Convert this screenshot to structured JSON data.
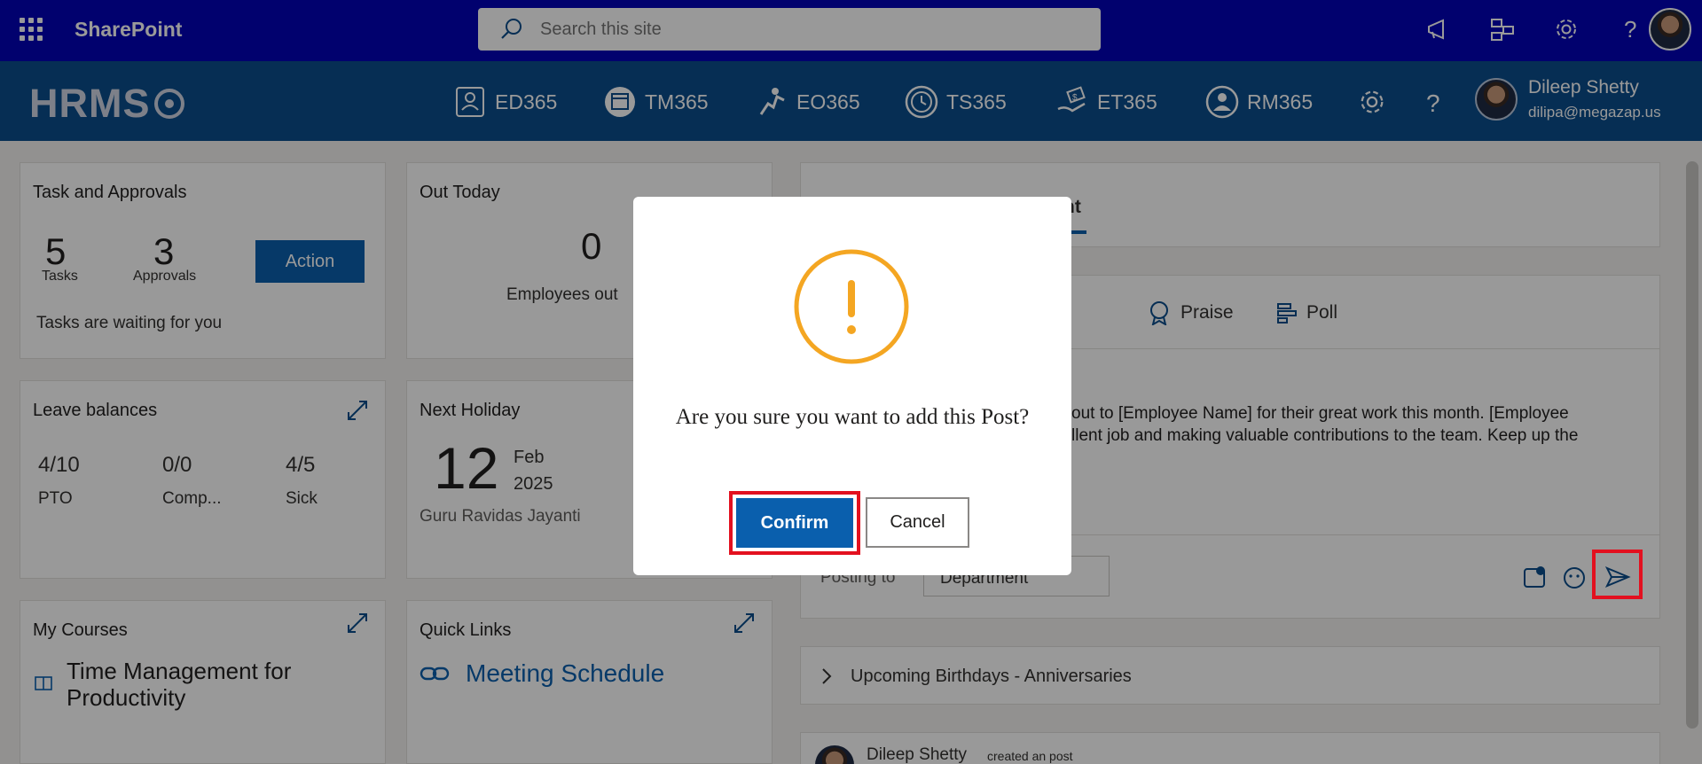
{
  "topbar": {
    "app_title": "SharePoint",
    "search_placeholder": "Search this site"
  },
  "hrms": {
    "logo": "HRMS",
    "nav": [
      {
        "label": "ED365",
        "icon": "employee-directory-icon"
      },
      {
        "label": "TM365",
        "icon": "calendar-icon"
      },
      {
        "label": "EO365",
        "icon": "onboarding-icon"
      },
      {
        "label": "TS365",
        "icon": "clock-icon"
      },
      {
        "label": "ET365",
        "icon": "expense-icon"
      },
      {
        "label": "RM365",
        "icon": "person-icon"
      }
    ],
    "user": {
      "name": "Dileep Shetty",
      "email": "dilipa@megazap.us"
    }
  },
  "tasks_card": {
    "title": "Task and Approvals",
    "tasks_count": "5",
    "tasks_label": "Tasks",
    "approvals_count": "3",
    "approvals_label": "Approvals",
    "action_label": "Action",
    "note": "Tasks are waiting for you"
  },
  "out_today": {
    "title": "Out Today",
    "count": "0",
    "label": "Employees out"
  },
  "leave": {
    "title": "Leave balances",
    "items": [
      {
        "value": "4/10",
        "label": "PTO"
      },
      {
        "value": "0/0",
        "label": "Comp..."
      },
      {
        "value": "4/5",
        "label": "Sick"
      }
    ]
  },
  "holiday": {
    "title": "Next Holiday",
    "day": "12",
    "month": "Feb",
    "year": "2025",
    "name": "Guru Ravidas Jayanti"
  },
  "courses": {
    "title": "My Courses",
    "course": "Time Management for Productivity"
  },
  "quick_links": {
    "title": "Quick Links",
    "link": "Meeting Schedule"
  },
  "post_panel": {
    "tab_partial": "nt",
    "type_partial": "ent",
    "praise": "Praise",
    "poll": "Poll",
    "text_line1": "out to [Employee Name] for their great work this month. [Employee",
    "text_line2": "llent job and making valuable contributions to the team. Keep up the",
    "posting_to_label": "Posting to",
    "posting_to_value": "Department"
  },
  "birthdays": {
    "label": "Upcoming Birthdays - Anniversaries"
  },
  "feed": {
    "author": "Dileep Shetty",
    "action": "created an post"
  },
  "dialog": {
    "message": "Are you sure you want to add this Post?",
    "confirm": "Confirm",
    "cancel": "Cancel"
  },
  "colors": {
    "sp_bar": "#0303b8",
    "hrms_bar": "#0a4d8c",
    "primary": "#0a5fad",
    "warning": "#f4a622",
    "highlight": "#e3101f"
  }
}
